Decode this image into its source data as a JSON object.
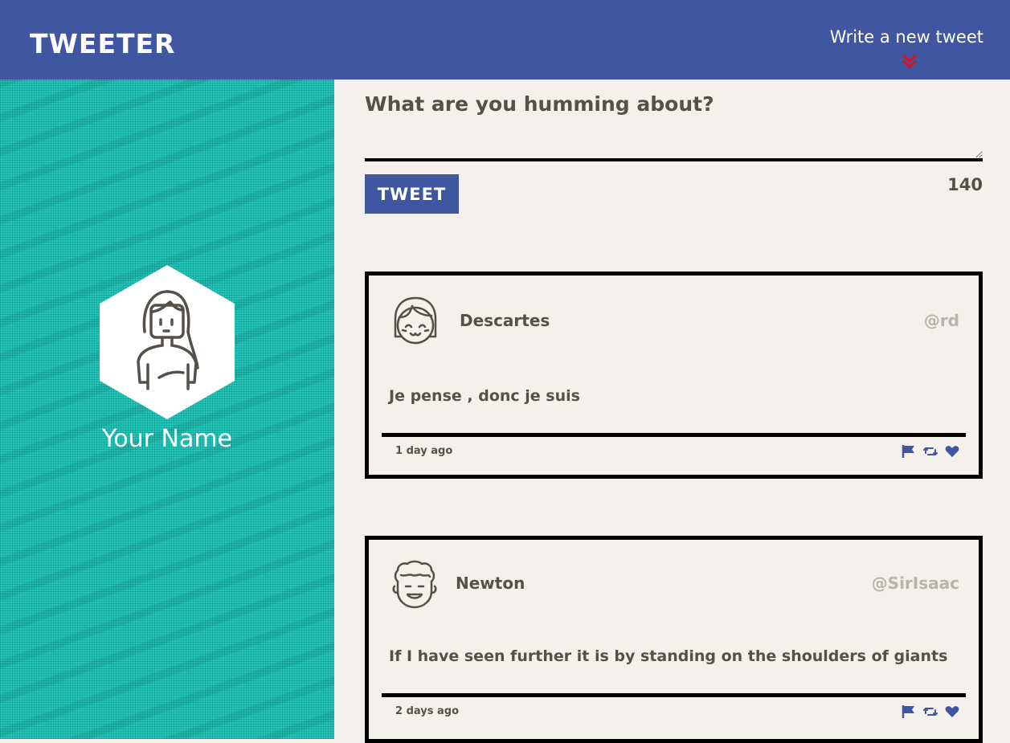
{
  "nav": {
    "brand": "TWEETER",
    "compose_link": "Write a new tweet",
    "compose_arrow_icon": "double-chevron-down-icon",
    "arrow_color": "#e0111c",
    "background": "#4056a1"
  },
  "profile": {
    "name": "Your Name",
    "avatar_icon": "woman-avatar-icon",
    "sidebar_color": "#23c7b9"
  },
  "compose": {
    "prompt": "What are you humming about?",
    "button_label": "TWEET",
    "char_counter": "140"
  },
  "tweets": [
    {
      "author": "Descartes",
      "handle": "@rd",
      "content": "Je pense , donc je suis",
      "timestamp": "1 day ago",
      "avatar_icon": "girl-avatar-icon"
    },
    {
      "author": "Newton",
      "handle": "@SirIsaac",
      "content": "If I have seen further it is by standing on the shoulders of giants",
      "timestamp": "2 days ago",
      "avatar_icon": "curly-hair-avatar-icon"
    }
  ],
  "actions": {
    "icons": [
      "flag-icon",
      "retweet-icon",
      "heart-icon"
    ],
    "color": "#4056a1"
  }
}
